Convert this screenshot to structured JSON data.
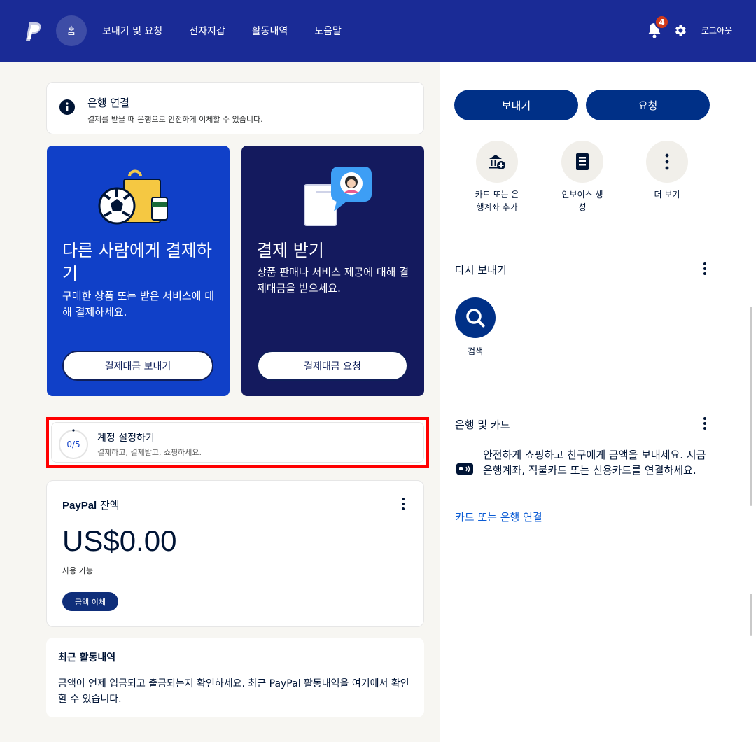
{
  "header": {
    "logo_icon": "paypal-logo",
    "nav": [
      {
        "label": "홈",
        "active": true
      },
      {
        "label": "보내기 및 요청",
        "active": false
      },
      {
        "label": "전자지갑",
        "active": false
      },
      {
        "label": "활동내역",
        "active": false
      },
      {
        "label": "도움말",
        "active": false
      }
    ],
    "notification_count": "4",
    "logout_label": "로그아웃"
  },
  "bank_banner": {
    "title": "은행 연결",
    "description": "결제를 받을 때 은행으로 안전하게 이체할 수 있습니다."
  },
  "promo_pay": {
    "title": "다른 사람에게 결제하기",
    "description": "구매한 상품 또는 받은 서비스에 대해 결제하세요.",
    "button": "결제대금 보내기"
  },
  "promo_get": {
    "title": "결제 받기",
    "description": "상품 판매나 서비스 제공에 대해 결제대금을 받으세요.",
    "button": "결제대금 요청"
  },
  "setup": {
    "progress": "0/5",
    "title": "계정 설정하기",
    "description": "결제하고, 결제받고, 쇼핑하세요."
  },
  "balance": {
    "brand": "PayPal",
    "label": " 잔액",
    "amount": "US$0.00",
    "available": "사용 가능",
    "transfer_button": "금액 이체"
  },
  "activity": {
    "title": "최근 활동내역",
    "description": "금액이 언제 입금되고 출금되는지 확인하세요. 최근 PayPal 활동내역을 여기에서 확인할 수 있습니다."
  },
  "right": {
    "send_button": "보내기",
    "request_button": "요청",
    "quick_actions": [
      {
        "label": "카드 또는 은행계좌 추가",
        "icon": "bank-add-icon"
      },
      {
        "label": "인보이스 생성",
        "icon": "invoice-icon"
      },
      {
        "label": "더 보기",
        "icon": "more-vertical-icon"
      }
    ],
    "send_again_title": "다시 보내기",
    "search_label": "검색",
    "bank_cards_title": "은행 및 카드",
    "bank_cards_message": "안전하게 쇼핑하고 친구에게 금액을 보내세요. 지금 은행계좌, 직불카드 또는 신용카드를 연결하세요.",
    "connect_link": "카드 또는 은행 연결"
  },
  "colors": {
    "header_bg": "#1a2b96",
    "pay_card_bg": "#1040c8",
    "get_card_bg": "#141a5e",
    "primary_button": "#003087",
    "link": "#0a5bd4",
    "highlight_border": "#ff0000"
  }
}
